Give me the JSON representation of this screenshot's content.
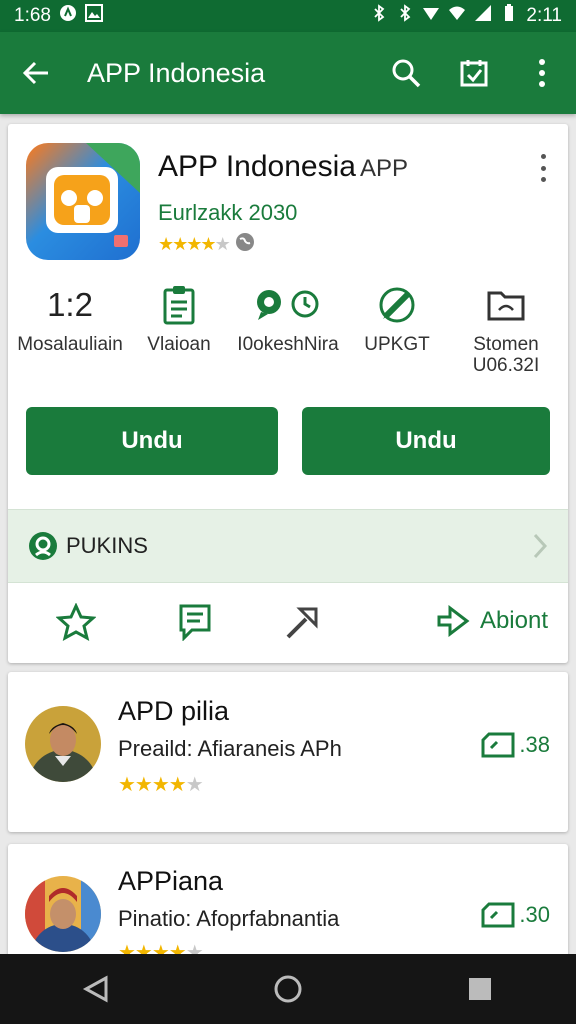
{
  "status_bar": {
    "time_left": "1:68",
    "time_right": "2:11"
  },
  "app_bar": {
    "title": "APP Indonesia"
  },
  "app": {
    "title": "APP Indonesia",
    "title_suffix": "APP",
    "developer": "Eurlzakk 2030",
    "rating_stars": 3.5
  },
  "stats": [
    {
      "value": "1:2",
      "label": "Mosalauliain",
      "icon": ""
    },
    {
      "value": "",
      "label": "Vlaioan",
      "icon": "clipboard-icon"
    },
    {
      "value": "",
      "label": "I0okeshNira",
      "icon": "chat-clock-icon"
    },
    {
      "value": "",
      "label": "UPKGT",
      "icon": "edit-icon"
    },
    {
      "value": "",
      "label": "Stomen\nU06.32I",
      "icon": "folder-icon"
    }
  ],
  "buttons": {
    "left": "Undu",
    "right": "Undu"
  },
  "banner": {
    "text": "PUKINS"
  },
  "actions": {
    "about_label": "Abiont"
  },
  "reviews": [
    {
      "name": "APD pilia",
      "text": "Preaild: Afiaraneis APh",
      "stars": 4,
      "count": ".38"
    },
    {
      "name": "APPiana",
      "text": "Pinatio: Afoprfabnantia",
      "stars": 4,
      "count": ".30"
    }
  ],
  "colors": {
    "primary": "#1a7b3c",
    "status_bar": "#0f6b32",
    "star": "#f2b600",
    "banner_bg": "#e6f1e6"
  }
}
